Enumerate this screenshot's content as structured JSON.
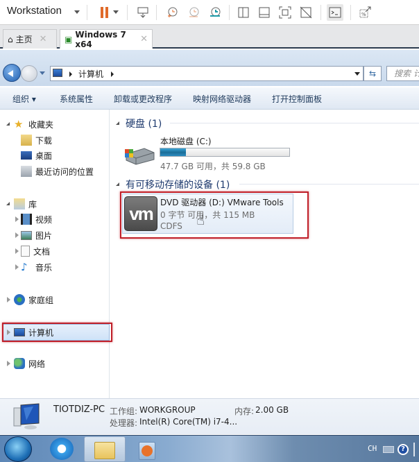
{
  "vmware": {
    "product_menu": "Workstation",
    "toolbar_icons": [
      "pause-icon",
      "send-ctrl-alt-del-icon",
      "snapshot-take-icon",
      "snapshot-revert-icon",
      "snapshot-manager-icon",
      "library-view-icon",
      "thumbnail-bar-icon",
      "fullscreen-icon",
      "unity-icon",
      "console-view-icon",
      "stretch-guest-icon"
    ],
    "tabs": [
      {
        "label": "主页",
        "icon": "home-icon",
        "active": false
      },
      {
        "label": "Windows 7 x64",
        "icon": "vm-running-icon",
        "active": true
      }
    ],
    "accent_color": "#e06a2a"
  },
  "explorer": {
    "breadcrumb": [
      "计算机"
    ],
    "search_placeholder": "搜索 计",
    "commands": [
      "组织 ▾",
      "系统属性",
      "卸载或更改程序",
      "映射网络驱动器",
      "打开控制面板"
    ],
    "sidebar": {
      "favorites": {
        "label": "收藏夹",
        "items": [
          "下载",
          "桌面",
          "最近访问的位置"
        ]
      },
      "libraries": {
        "label": "库",
        "items": [
          "视频",
          "图片",
          "文档",
          "音乐"
        ]
      },
      "homegroup": "家庭组",
      "computer": "计算机",
      "network": "网络"
    },
    "groups": {
      "hard_disks": {
        "title": "硬盘 (1)",
        "drives": [
          {
            "name": "本地磁盘 (C:)",
            "free_text": "47.7 GB 可用，共 59.8 GB",
            "used_fraction": 0.2
          }
        ]
      },
      "removable": {
        "title": "有可移动存储的设备 (1)",
        "drives": [
          {
            "name": "DVD 驱动器 (D:) VMware Tools",
            "free_text": "0 字节 可用，共 115 MB",
            "filesystem": "CDFS",
            "logo_text": "vm"
          }
        ]
      }
    },
    "details": {
      "pc_name": "TIOTDIZ-PC",
      "workgroup_label": "工作组:",
      "workgroup_value": "WORKGROUP",
      "memory_label": "内存:",
      "memory_value": "2.00 GB",
      "cpu_label": "处理器:",
      "cpu_value": "Intel(R) Core(TM) i7-4..."
    }
  },
  "taskbar": {
    "items": [
      "start-orb",
      "internet-explorer",
      "windows-explorer",
      "media-player"
    ],
    "tray": {
      "language": "CH",
      "help": "?"
    }
  }
}
